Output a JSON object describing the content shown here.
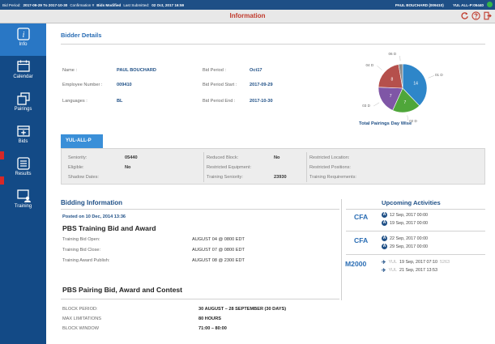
{
  "status_bar": {
    "bid_period_label": "Bid Period:",
    "bid_period_value": "2017-09-29 To 2017-10-30",
    "confirmation_label": "Confirmation #",
    "bids_modified_label": "Bids Modified",
    "last_submitted_label": "Last Submitted:",
    "last_submitted_value": "02 Oct, 2017 16:59",
    "user": "PAUL BOUCHARD (009410)",
    "base_seniority": "YUL ALL-P:05440",
    "online_color": "#35b54a"
  },
  "title_bar": {
    "title": "Information",
    "icons": [
      "refresh-icon",
      "help-icon",
      "logout-icon"
    ]
  },
  "sidebar": {
    "items": [
      {
        "label": "Info",
        "icon": "info-icon",
        "active": true
      },
      {
        "label": "Calendar",
        "icon": "calendar-icon",
        "active": false
      },
      {
        "label": "Pairings",
        "icon": "pairings-icon",
        "active": false
      },
      {
        "label": "Bids",
        "icon": "bids-icon",
        "active": false
      },
      {
        "label": "Results",
        "icon": "results-icon",
        "active": false
      },
      {
        "label": "Training",
        "icon": "training-icon",
        "active": false
      }
    ]
  },
  "bidder_details": {
    "heading": "Bidder Details",
    "name_label": "Name :",
    "name_value": "PAUL BOUCHARD",
    "employee_number_label": "Employee Number :",
    "employee_number_value": "009410",
    "languages_label": "Languages :",
    "languages_value": "BL",
    "bid_period_label": "Bid Period :",
    "bid_period_value": "Oct17",
    "bid_period_start_label": "Bid Period Start :",
    "bid_period_start_value": "2017-09-29",
    "bid_period_end_label": "Bid Period End :",
    "bid_period_end_value": "2017-10-30"
  },
  "chart_data": {
    "type": "pie",
    "title": "Total Pairings Day Wise",
    "slices": [
      {
        "label": "01 D",
        "value": 14,
        "color": "#2e86c9"
      },
      {
        "label": "02 D",
        "value": 7,
        "color": "#4fa63a"
      },
      {
        "label": "03 D",
        "value": 7,
        "color": "#7f56a6"
      },
      {
        "label": "04 D",
        "value": 8,
        "color": "#b5504c"
      },
      {
        "label": "06 D",
        "value": 1,
        "color": "#8a8a8a"
      }
    ]
  },
  "seniority_tab": {
    "tab_label": "YUL-ALL-P",
    "seniority_label": "Seniority:",
    "seniority_value": "05440",
    "eligible_label": "Eligible:",
    "eligible_value": "No",
    "shadow_dates_label": "Shadow Dates:",
    "reduced_block_label": "Reduced Block:",
    "reduced_block_value": "No",
    "restricted_equipment_label": "Restricted Equipment:",
    "training_seniority_label": "Training Seniority:",
    "training_seniority_value": "23930",
    "restricted_location_label": "Restricted Location:",
    "restricted_positions_label": "Restricted Positions:",
    "training_requirements_label": "Training Requirements:"
  },
  "bidding_information": {
    "heading": "Bidding Information",
    "posted": "Posted on 10 Dec, 2014 13:36",
    "training_title": "PBS Training Bid and Award",
    "rows": [
      {
        "label": "Training Bid Open:",
        "value": "AUGUST 04  @ 0800 EDT"
      },
      {
        "label": "Training Bid Close:",
        "value": "AUGUST 07  @ 0800 EDT"
      },
      {
        "label": "Training Award Publish:",
        "value": "AUGUST 08  @ 2300 EDT"
      }
    ],
    "pairing_title": "PBS Pairing Bid, Award and Contest",
    "pairing_rows": [
      {
        "label": "BLOCK PERIOD:",
        "value": "30 AUGUST – 28 SEPTEMBER (30 DAYS)"
      },
      {
        "label": "MAX LIMITATIONS",
        "value": "80 HOURS"
      },
      {
        "label": "BLOCK WINDOW",
        "value": "71:00 – 80:00"
      }
    ]
  },
  "upcoming_activities": {
    "heading": "Upcoming Activities",
    "groups": [
      {
        "code": "CFA",
        "lines": [
          {
            "mark": "A",
            "text": "12 Sep, 2017 00:00"
          },
          {
            "mark": "A",
            "text": "19 Sep, 2017 00:00"
          }
        ]
      },
      {
        "code": "CFA",
        "lines": [
          {
            "mark": "A",
            "text": "22 Sep, 2017 00:00"
          },
          {
            "mark": "A",
            "text": "29 Sep, 2017 00:00"
          }
        ]
      },
      {
        "code": "M2000",
        "lines": [
          {
            "mark": "✈",
            "station": "YUL",
            "text": "19 Sep, 2017 07:10",
            "flight": "5263"
          },
          {
            "mark": "✈",
            "station": "YUL",
            "text": "21 Sep, 2017 13:53",
            "flight": ""
          }
        ]
      }
    ]
  }
}
